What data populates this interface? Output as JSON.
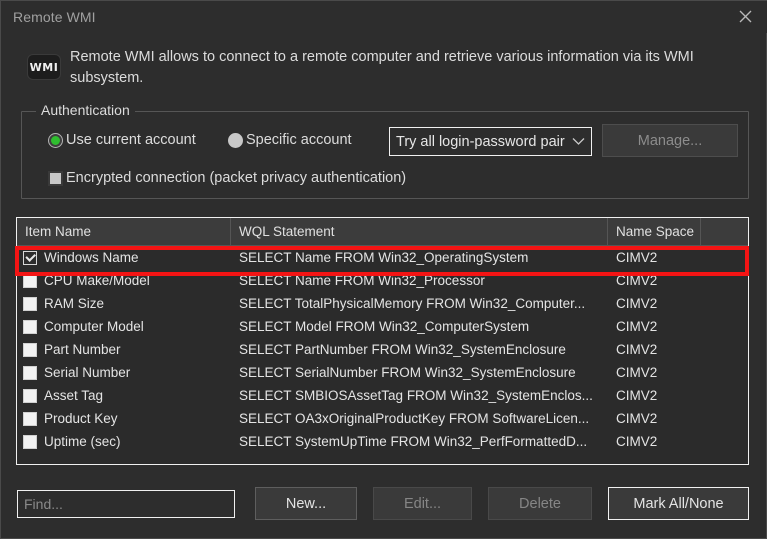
{
  "window": {
    "title": "Remote WMI",
    "close_icon": "close-icon"
  },
  "header": {
    "icon_label": "WMI",
    "description": "Remote WMI allows to connect to a remote computer and retrieve various information via its WMI subsystem."
  },
  "authentication": {
    "group_title": "Authentication",
    "radio_current": "Use current account",
    "radio_specific": "Specific account",
    "selected_radio": "Use current account",
    "checkbox_encrypted": "Encrypted connection (packet privacy authentication)",
    "encrypted_checked": "false",
    "credentials_combo": {
      "value": "Try all login-password pair",
      "arrow_icon": "chevron-down-icon"
    },
    "manage_button": "Manage...",
    "manage_enabled": "false"
  },
  "list": {
    "columns": [
      "Item Name",
      "WQL Statement",
      "Name Space",
      ""
    ],
    "rows": [
      {
        "checked": true,
        "name": "Windows Name",
        "wql": "SELECT Name FROM Win32_OperatingSystem",
        "ns": "CIMV2",
        "highlighted": true
      },
      {
        "checked": false,
        "name": "CPU Make/Model",
        "wql": "SELECT Name FROM Win32_Processor",
        "ns": "CIMV2",
        "highlighted": false
      },
      {
        "checked": false,
        "name": "RAM Size",
        "wql": "SELECT TotalPhysicalMemory FROM Win32_Computer...",
        "ns": "CIMV2",
        "highlighted": false
      },
      {
        "checked": false,
        "name": "Computer Model",
        "wql": "SELECT Model FROM Win32_ComputerSystem",
        "ns": "CIMV2",
        "highlighted": false
      },
      {
        "checked": false,
        "name": "Part Number",
        "wql": "SELECT PartNumber FROM Win32_SystemEnclosure",
        "ns": "CIMV2",
        "highlighted": false
      },
      {
        "checked": false,
        "name": "Serial Number",
        "wql": "SELECT SerialNumber FROM Win32_SystemEnclosure",
        "ns": "CIMV2",
        "highlighted": false
      },
      {
        "checked": false,
        "name": "Asset Tag",
        "wql": "SELECT SMBIOSAssetTag FROM Win32_SystemEnclos...",
        "ns": "CIMV2",
        "highlighted": false
      },
      {
        "checked": false,
        "name": "Product Key",
        "wql": "SELECT OA3xOriginalProductKey FROM SoftwareLicen...",
        "ns": "CIMV2",
        "highlighted": false
      },
      {
        "checked": false,
        "name": "Uptime (sec)",
        "wql": "SELECT SystemUpTime FROM Win32_PerfFormattedD...",
        "ns": "CIMV2",
        "highlighted": false
      }
    ]
  },
  "footer": {
    "find_placeholder": "Find...",
    "find_value": "",
    "new_button": "New...",
    "edit_button": "Edit...",
    "delete_button": "Delete",
    "mark_button": "Mark All/None",
    "edit_enabled": "false",
    "delete_enabled": "false"
  },
  "colors": {
    "accent_radio": "#2fbe2f",
    "annotation": "#f41414",
    "dialog_bg": "#2d2d2d",
    "text": "#dcdcdc"
  }
}
